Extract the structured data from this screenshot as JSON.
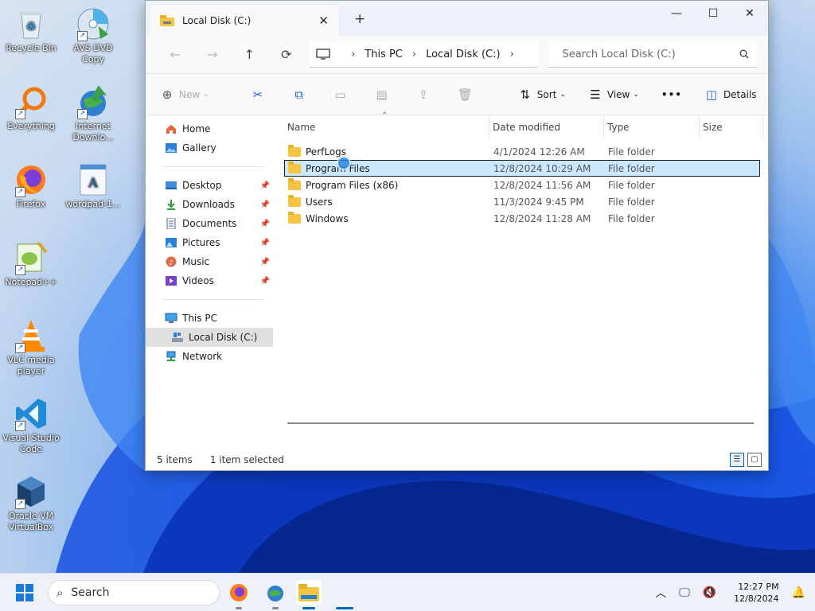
{
  "desktop": {
    "icons": [
      {
        "label": "Recycle Bin"
      },
      {
        "label": "AVS DVD Copy"
      },
      {
        "label": "Everything"
      },
      {
        "label": "Internet Downlo..."
      },
      {
        "label": "Firefox"
      },
      {
        "label": "wordpad-1..."
      },
      {
        "label": "Notepad++"
      },
      {
        "label": "VLC media player"
      },
      {
        "label": "Visual Studio Code"
      },
      {
        "label": "Oracle VM VirtualBox"
      }
    ]
  },
  "window": {
    "tab_title": "Local Disk (C:)",
    "tab_close": "✕",
    "new_tab": "+",
    "controls": {
      "minimize": "—",
      "maximize": "☐",
      "close": "✕"
    }
  },
  "address": {
    "back": "←",
    "forward": "→",
    "up": "↑",
    "refresh": "⟳",
    "crumbs": [
      "This PC",
      "Local Disk (C:)"
    ],
    "search_placeholder": "Search Local Disk (C:)"
  },
  "toolbar": {
    "new_label": "New",
    "sort_label": "Sort",
    "view_label": "View",
    "more_label": "•••",
    "details_label": "Details"
  },
  "navpane": {
    "top": [
      {
        "label": "Home"
      },
      {
        "label": "Gallery"
      }
    ],
    "quick": [
      {
        "label": "Desktop"
      },
      {
        "label": "Downloads"
      },
      {
        "label": "Documents"
      },
      {
        "label": "Pictures"
      },
      {
        "label": "Music"
      },
      {
        "label": "Videos"
      }
    ],
    "devices": [
      {
        "label": "This PC"
      },
      {
        "label": "Local Disk (C:)"
      },
      {
        "label": "Network"
      }
    ]
  },
  "files": {
    "columns": {
      "name": "Name",
      "date": "Date modified",
      "type": "Type",
      "size": "Size"
    },
    "rows": [
      {
        "name": "PerfLogs",
        "date": "4/1/2024 12:26 AM",
        "type": "File folder"
      },
      {
        "name": "Program Files",
        "date": "12/8/2024 10:29 AM",
        "type": "File folder"
      },
      {
        "name": "Program Files (x86)",
        "date": "12/8/2024 11:56 AM",
        "type": "File folder"
      },
      {
        "name": "Users",
        "date": "11/3/2024 9:45 PM",
        "type": "File folder"
      },
      {
        "name": "Windows",
        "date": "12/8/2024 11:28 AM",
        "type": "File folder"
      }
    ]
  },
  "status": {
    "items": "5 items",
    "selected": "1 item selected"
  },
  "taskbar": {
    "search_label": "Search",
    "time": "12:27 PM",
    "date": "12/8/2024"
  },
  "colors": {
    "accent": "#0067c0",
    "selection": "#cce8ff",
    "folder": "#f5c542"
  }
}
